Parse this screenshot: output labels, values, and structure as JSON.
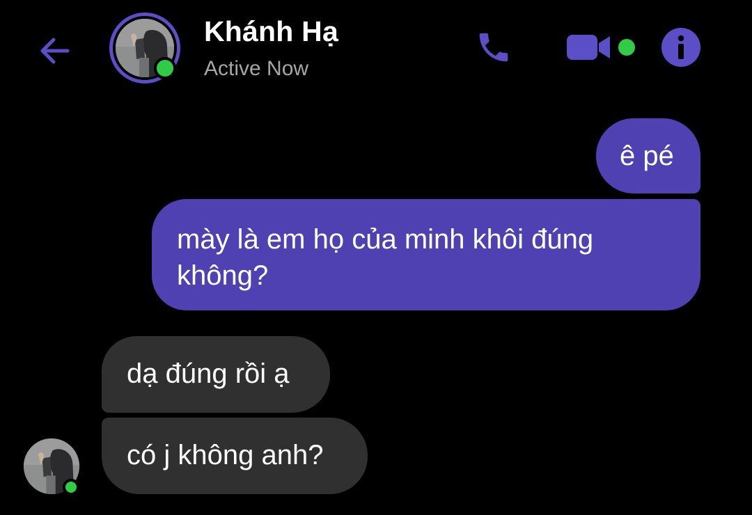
{
  "header": {
    "back_icon": "arrow-left-icon",
    "contact_name": "Khánh Hạ",
    "status": "Active Now",
    "presence": "online",
    "actions": [
      {
        "name": "call",
        "icon": "phone-icon"
      },
      {
        "name": "video-call",
        "icon": "video-camera-icon"
      },
      {
        "name": "info",
        "icon": "info-icon"
      }
    ]
  },
  "messages": [
    {
      "direction": "outgoing",
      "text": "ê pé"
    },
    {
      "direction": "outgoing",
      "text": "mày là em họ của minh khôi đúng không?"
    },
    {
      "direction": "incoming",
      "text": "dạ đúng rồi ạ"
    },
    {
      "direction": "incoming",
      "text": "có j không anh?"
    }
  ],
  "colors": {
    "background": "#000000",
    "accent": "#5b4ec7",
    "outgoing_bubble": "#4f41b1",
    "incoming_bubble": "#303030",
    "presence_green": "#31cc46",
    "status_text": "#a7a7a7"
  }
}
